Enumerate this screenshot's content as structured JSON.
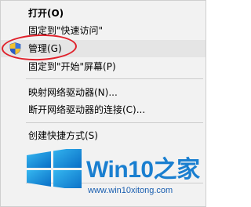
{
  "context_menu": {
    "items": [
      {
        "label": "打开(O)"
      },
      {
        "label": "固定到\"快速访问\""
      },
      {
        "label": "管理(G)"
      },
      {
        "label": "固定到\"开始\"屏幕(P)"
      },
      {
        "label": "映射网络驱动器(N)..."
      },
      {
        "label": "断开网络驱动器的连接(C)..."
      },
      {
        "label": "创建快捷方式(S)"
      }
    ],
    "icons": {
      "manage": "uac-shield-icon"
    }
  },
  "watermark": {
    "brand_prefix": "Win10",
    "brand_suffix": "之家",
    "url": "www.win10xitong.com",
    "logo_icon": "windows-logo-icon"
  },
  "colors": {
    "menu_background": "#f2f2f2",
    "hover_background": "#e5e5e5",
    "highlight_circle": "#e0202a",
    "brand_blue": "#1a7fd0"
  }
}
